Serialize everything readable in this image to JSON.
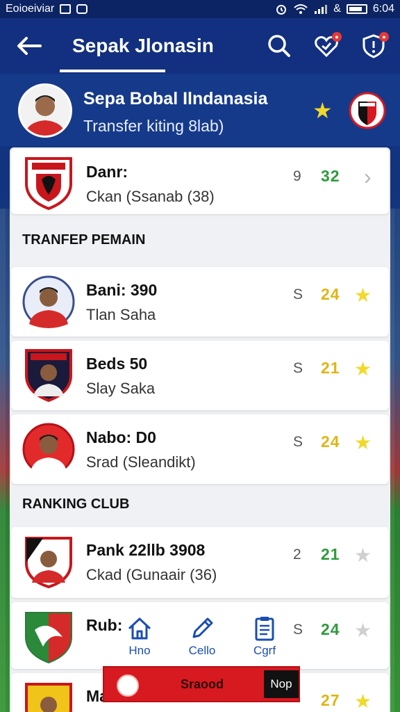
{
  "statusbar": {
    "left_text": "Eoioeiviar",
    "time": "6:04",
    "ampersand": "&"
  },
  "appbar": {
    "title": "Sepak Jlonasin"
  },
  "profile": {
    "name": "Sepa Bobal Ilndanasia",
    "subtitle": "Transfer kiting 8lab)"
  },
  "club_card": {
    "line1": "Danr:",
    "line2": "Ckan (Ssanab (38)",
    "meta": "9",
    "score": "32"
  },
  "transfer": {
    "section_title": "TRANFEP PEMAIN",
    "items": [
      {
        "line1": "Bani: 390",
        "line2": "Tlan Saha",
        "meta": "S",
        "score": "24"
      },
      {
        "line1": "Beds 50",
        "line2": "Slay Saka",
        "meta": "S",
        "score": "21"
      },
      {
        "line1": "Nabo: D0",
        "line2": "Srad (Sleandikt)",
        "meta": "S",
        "score": "24"
      }
    ]
  },
  "ranking": {
    "section_title": "RANKING CLUB",
    "items": [
      {
        "line1": "Pank 22llb 3908",
        "line2": "Ckad (Gunaair (36)",
        "meta": "2",
        "score": "21"
      },
      {
        "line1": "Rub:",
        "line2": "",
        "meta": "S",
        "score": "24"
      },
      {
        "line1": "Ma",
        "line2": "",
        "meta": "",
        "score": "27"
      }
    ]
  },
  "nav": [
    {
      "label": "Hno",
      "icon": "home-icon"
    },
    {
      "label": "Cello",
      "icon": "pencil-icon"
    },
    {
      "label": "Cgrf",
      "icon": "clipboard-icon"
    }
  ],
  "red_bar": {
    "label": "Sraood",
    "button": "Nop"
  },
  "colors": {
    "primary": "#12307f",
    "accent_red": "#d71920",
    "score_green": "#2e9b3c",
    "score_gold": "#e0b515",
    "star_gold": "#f1d92a"
  }
}
